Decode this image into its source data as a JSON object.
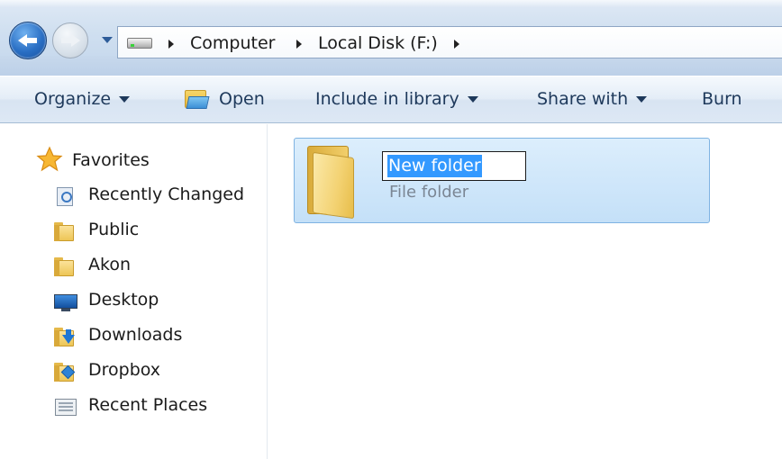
{
  "breadcrumb": {
    "items": [
      "Computer",
      "Local Disk (F:)"
    ]
  },
  "command_bar": {
    "organize": "Organize",
    "open": "Open",
    "include_in_library": "Include in library",
    "share_with": "Share with",
    "burn": "Burn"
  },
  "navigation": {
    "favorites_label": "Favorites",
    "items": [
      {
        "label": "Recently Changed",
        "icon": "recently-changed-icon"
      },
      {
        "label": "Public",
        "icon": "folder-icon"
      },
      {
        "label": "Akon",
        "icon": "folder-icon"
      },
      {
        "label": "Desktop",
        "icon": "desktop-icon"
      },
      {
        "label": "Downloads",
        "icon": "downloads-icon"
      },
      {
        "label": "Dropbox",
        "icon": "dropbox-icon"
      },
      {
        "label": "Recent Places",
        "icon": "recent-places-icon"
      }
    ]
  },
  "content": {
    "item": {
      "name": "New folder",
      "type": "File folder",
      "icon": "folder-icon"
    }
  },
  "colors": {
    "selection": "#3399ff",
    "selected_item_bg": "#c4e0f8",
    "text": "#1e395b"
  }
}
